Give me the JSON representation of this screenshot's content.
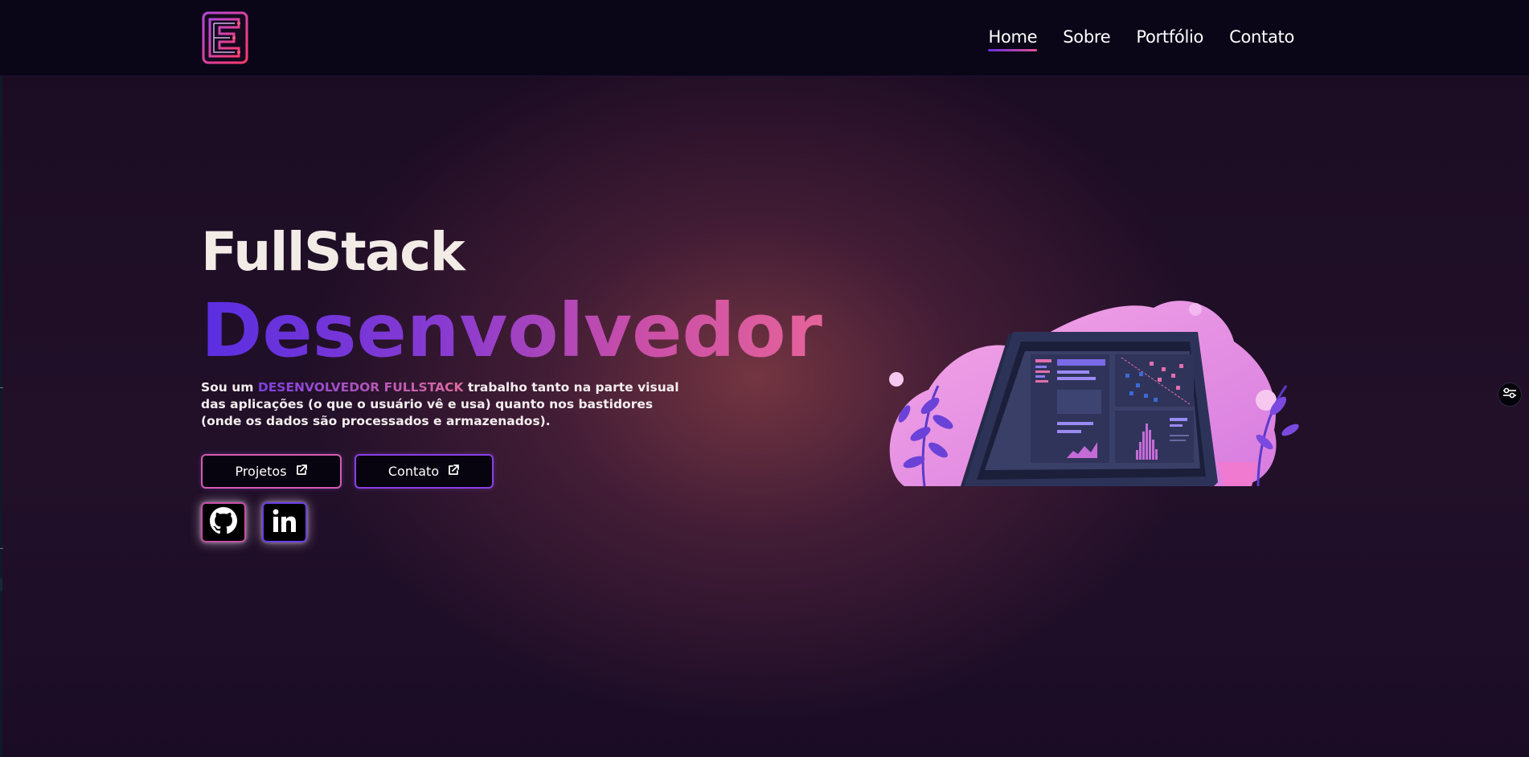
{
  "header": {
    "logo_label": "E",
    "nav": [
      {
        "label": "Home",
        "active": true
      },
      {
        "label": "Sobre",
        "active": false
      },
      {
        "label": "Portfólio",
        "active": false
      },
      {
        "label": "Contato",
        "active": false
      }
    ]
  },
  "hero": {
    "title_line1": "FullStack",
    "title_line2": "Desenvolvedor",
    "intro_prefix": "Sou um ",
    "intro_highlight": "DESENVOLVEDOR FULLSTACK",
    "intro_suffix": " trabalho tanto na parte visual das aplicações (o que o usuário vê e usa) quanto nos bastidores (onde os dados são processados e armazenados).",
    "buttons": {
      "projetos": "Projetos",
      "contato": "Contato"
    },
    "social": {
      "github_icon": "github-icon",
      "linkedin_icon": "linkedin-icon"
    }
  },
  "icons": {
    "external_link": "external-link-icon",
    "settings": "settings-sliders-icon"
  },
  "colors": {
    "header_bg": "#0a0618",
    "accent_purple": "#5a2ee2",
    "accent_pink": "#e5639a",
    "text": "#f3ebe6"
  }
}
